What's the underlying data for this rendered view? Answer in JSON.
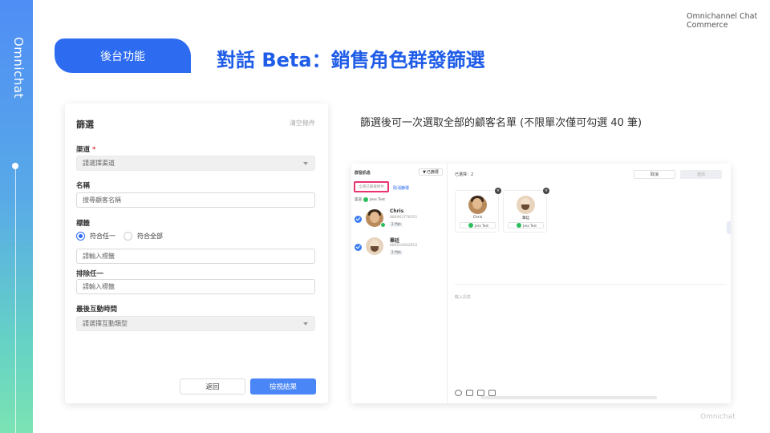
{
  "brand": {
    "rail_text": "Omnichat",
    "corner_title": "Omnichannel Chat Commerce",
    "footer": "Omnichat"
  },
  "header": {
    "tag": "後台功能",
    "title": "對話 Beta：銷售角色群發篩選"
  },
  "filter_panel": {
    "title": "篩選",
    "clear_label": "清空條件",
    "channel_label": "渠道",
    "channel_required": "*",
    "channel_placeholder": "請選擇渠道",
    "name_label": "名稱",
    "name_placeholder": "搜尋顧客名稱",
    "tag_label": "標籤",
    "radio_any": "符合任一",
    "radio_all": "符合全部",
    "tag_placeholder": "請輸入標籤",
    "exclude_label": "排除任一",
    "exclude_placeholder": "請輸入標籤",
    "last_time_label": "最後互動時間",
    "last_time_placeholder": "請選擇互動類型",
    "back_button": "返回",
    "view_button": "檢視結果"
  },
  "description": "篩選後可一次選取全部的顧客名單 (不限單次僅可勾選 40 筆)",
  "chat": {
    "left_title": "群發訊息",
    "filter_btn": "已篩選",
    "select_all": "全選已篩選條件",
    "cancel_filter": "取消篩選",
    "channel_prefix": "渠道",
    "channel_name": "Jess Test",
    "contacts": [
      {
        "name": "Chris",
        "phone": "886963778351",
        "tag": "2 門市"
      },
      {
        "name": "畢廷",
        "phone": "886910402852",
        "tag": "2 門市"
      }
    ],
    "selected_count": "已選擇：2",
    "cancel_btn": "取消",
    "send_btn": "送出",
    "cards": [
      {
        "name": "Chris",
        "channel": "Jess Test"
      },
      {
        "name": "畢廷",
        "channel": "Jess Test"
      }
    ],
    "input_placeholder": "輸入訊息"
  }
}
